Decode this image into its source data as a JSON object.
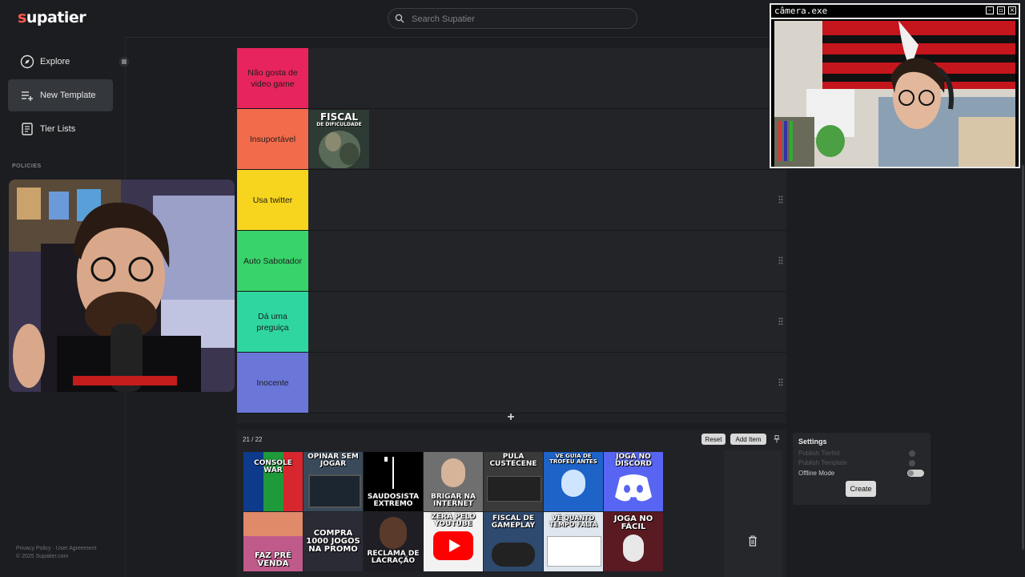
{
  "app": {
    "logo": "supatier",
    "logo_first_letter": "s",
    "logo_rest": "upatier"
  },
  "search": {
    "placeholder": "Search Supatier"
  },
  "sidebar": {
    "items": [
      {
        "label": "Explore",
        "icon": "compass-icon"
      },
      {
        "label": "New Template",
        "icon": "list-plus-icon",
        "active": true
      },
      {
        "label": "Tier Lists",
        "icon": "newspaper-icon"
      }
    ],
    "section": "POLICIES",
    "footer_links": "Privacy Policy · User Agreement",
    "copyright": "© 2025 Supatier.com"
  },
  "tiers": [
    {
      "label": "Não gosta de video game",
      "color": "#e8245c"
    },
    {
      "label": "Insuportável",
      "color": "#f26b4b",
      "item": {
        "caption": "FISCAL",
        "subcaption": "DE DIFICULDADE"
      }
    },
    {
      "label": "Usa twitter",
      "color": "#f7d41e"
    },
    {
      "label": "Auto Sabotador",
      "color": "#38d36a"
    },
    {
      "label": "Dá uma preguiça",
      "color": "#2fd6a0"
    },
    {
      "label": "Inocente",
      "color": "#6a76d8"
    }
  ],
  "pool": {
    "count": "21 / 22",
    "reset_label": "Reset",
    "add_item_label": "Add Item",
    "items": [
      {
        "caption": "CONSOLE WAR",
        "bg": "#1f5fb5"
      },
      {
        "caption": "OPINAR SEM JOGAR",
        "bg": "#3a4a5a"
      },
      {
        "caption": "SAUDOSISTA EXTREMO",
        "bg": "#000000"
      },
      {
        "caption": "BRIGAR NA INTERNET",
        "bg": "#6f6f6f"
      },
      {
        "caption": "PULA CUSTECENE",
        "bg": "#3a3a3a"
      },
      {
        "caption": "VE GUIA DE TROFEU ANTES",
        "bg": "#1d63c8"
      },
      {
        "caption": "JOGA NO DISCORD",
        "bg": "#5865f2"
      },
      {
        "caption": "FAZ PRÉ VENDA",
        "bg": "#c05a8a"
      },
      {
        "caption": "COMPRA 1000 JOGOS NA PROMO",
        "bg": "#2b2b35"
      },
      {
        "caption": "RECLAMA DE LACRAÇÃO",
        "bg": "#1f1e24"
      },
      {
        "caption": "ZERA PELO YOUTUBE",
        "bg": "#f2f2f2"
      },
      {
        "caption": "FISCAL DE GAMEPLAY",
        "bg": "#2e4a6e"
      },
      {
        "caption": "VÊ QUANTO TEMPO FALTA",
        "bg": "#dfe6ee"
      },
      {
        "caption": "JOGA NO FÁCIL",
        "bg": "#5a1a22"
      }
    ]
  },
  "settings": {
    "title": "Settings",
    "rows": [
      {
        "label": "Publish Tierlist",
        "enabled": false
      },
      {
        "label": "Publish Template",
        "enabled": false
      },
      {
        "label": "Offline Mode",
        "enabled": true
      }
    ],
    "create_label": "Create"
  },
  "camera_window": {
    "title": "câmera.exe",
    "min": "–",
    "max": "▫",
    "close": "×"
  },
  "colors": {
    "accent": "#ff5a4a",
    "bg": "#1b1d20",
    "panel": "#202226"
  }
}
